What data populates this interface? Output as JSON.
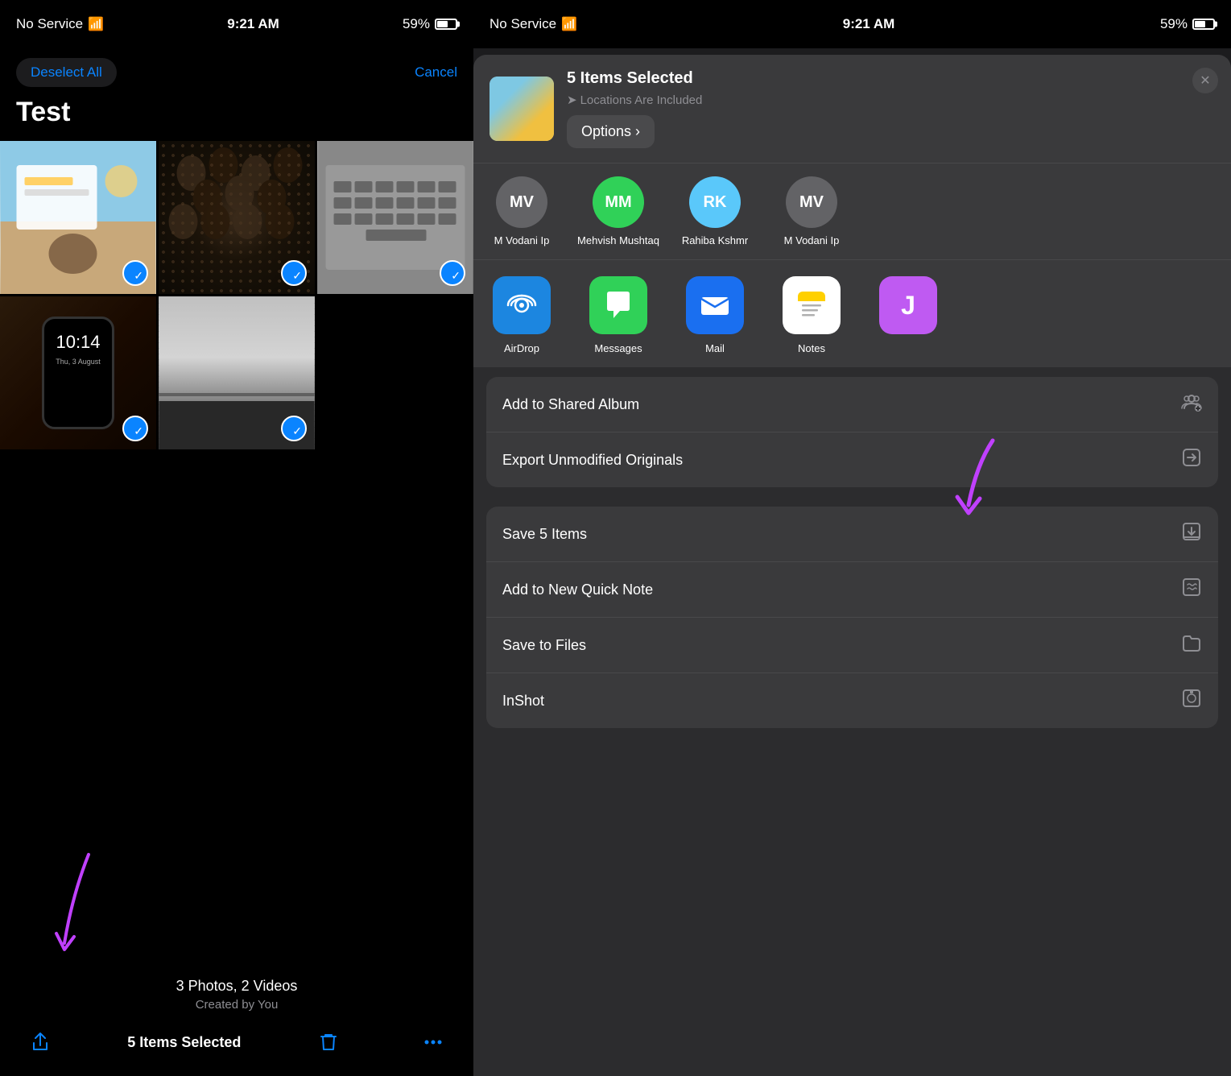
{
  "left": {
    "status": {
      "no_service": "No Service",
      "time": "9:21 AM",
      "battery": "59%"
    },
    "deselect_label": "Deselect All",
    "cancel_label": "Cancel",
    "page_title": "Test",
    "album_info": {
      "title": "3 Photos, 2 Videos",
      "subtitle": "Created by You"
    },
    "items_selected": "5 Items Selected"
  },
  "right": {
    "status": {
      "no_service": "No Service",
      "time": "9:21 AM",
      "battery": "59%"
    },
    "share_header": {
      "title": "5 Items Selected",
      "subtitle": "Locations Are Included",
      "options_label": "Options ›",
      "close_label": "✕"
    },
    "contacts": [
      {
        "name": "M Vodani Ip",
        "initials": "MV",
        "color": "gray"
      },
      {
        "name": "Mehvish Mushtaq",
        "initials": "MM",
        "color": "green"
      },
      {
        "name": "Rahiba Kshmr",
        "initials": "RK",
        "color": "teal"
      },
      {
        "name": "M Vodani Ip",
        "initials": "MV",
        "color": "gray"
      }
    ],
    "apps": [
      {
        "name": "AirDrop",
        "icon": "airdrop"
      },
      {
        "name": "Messages",
        "icon": "messages"
      },
      {
        "name": "Mail",
        "icon": "mail"
      },
      {
        "name": "Notes",
        "icon": "notes"
      },
      {
        "name": "J",
        "icon": "purple"
      }
    ],
    "action_groups": [
      {
        "items": [
          {
            "label": "Add to Shared Album",
            "icon": "shared-album"
          },
          {
            "label": "Export Unmodified Originals",
            "icon": "export"
          }
        ]
      },
      {
        "items": [
          {
            "label": "Save 5 Items",
            "icon": "save"
          },
          {
            "label": "Add to New Quick Note",
            "icon": "quick-note"
          },
          {
            "label": "Save to Files",
            "icon": "files"
          },
          {
            "label": "InShot",
            "icon": "inshot"
          }
        ]
      }
    ]
  }
}
